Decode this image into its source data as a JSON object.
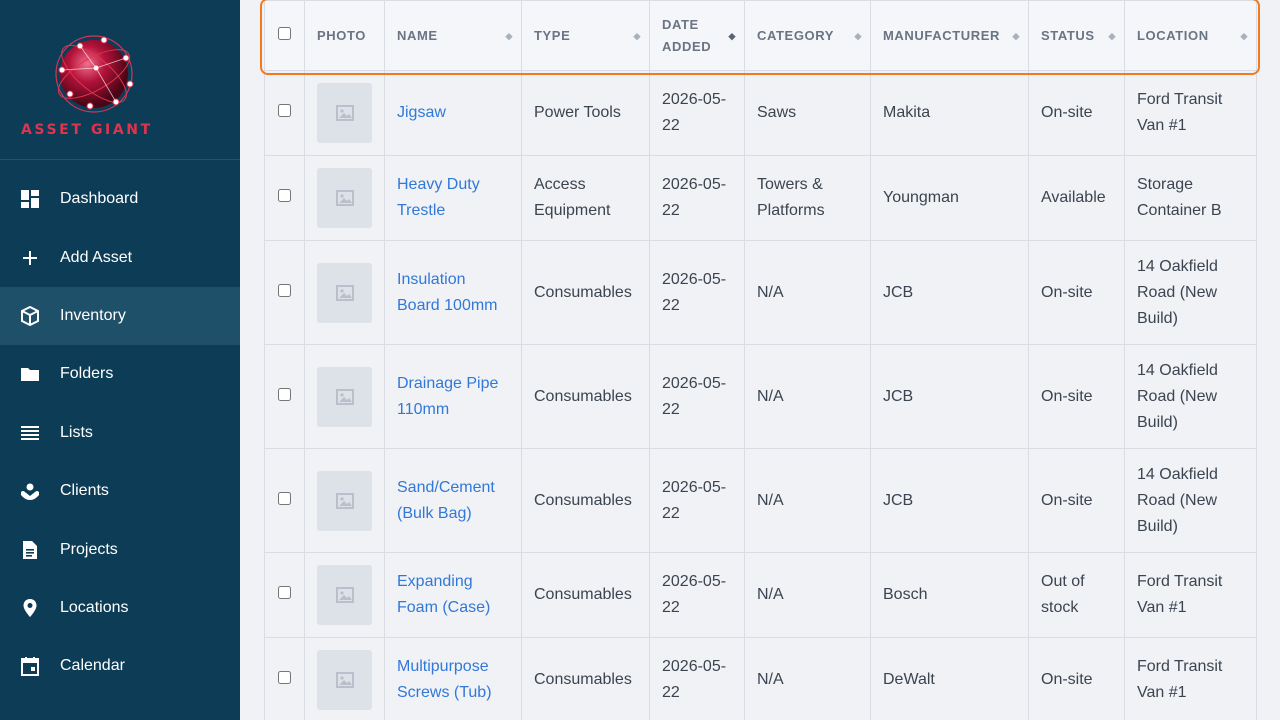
{
  "brand": {
    "name": "ASSET GIANT"
  },
  "sidebar": {
    "items": [
      {
        "label": "Dashboard",
        "icon": "dashboard-icon",
        "active": false
      },
      {
        "label": "Add Asset",
        "icon": "plus-icon",
        "active": false
      },
      {
        "label": "Inventory",
        "icon": "box-icon",
        "active": true
      },
      {
        "label": "Folders",
        "icon": "folder-icon",
        "active": false
      },
      {
        "label": "Lists",
        "icon": "list-icon",
        "active": false
      },
      {
        "label": "Clients",
        "icon": "clients-icon",
        "active": false
      },
      {
        "label": "Projects",
        "icon": "document-icon",
        "active": false
      },
      {
        "label": "Locations",
        "icon": "location-pin-icon",
        "active": false
      },
      {
        "label": "Calendar",
        "icon": "calendar-icon",
        "active": false
      }
    ]
  },
  "table": {
    "columns": [
      "PHOTO",
      "NAME",
      "TYPE",
      "DATE ADDED",
      "CATEGORY",
      "MANUFACTURER",
      "STATUS",
      "LOCATION"
    ],
    "sorted_column": "DATE ADDED",
    "rows": [
      {
        "name": "Jigsaw",
        "type": "Power Tools",
        "date": "2026-05-22",
        "category": "Saws",
        "manufacturer": "Makita",
        "status": "On-site",
        "location": "Ford Transit Van #1"
      },
      {
        "name": "Heavy Duty Trestle",
        "type": "Access Equipment",
        "date": "2026-05-22",
        "category": "Towers & Platforms",
        "manufacturer": "Youngman",
        "status": "Available",
        "location": "Storage Container B"
      },
      {
        "name": "Insulation Board 100mm",
        "type": "Consumables",
        "date": "2026-05-22",
        "category": "N/A",
        "manufacturer": "JCB",
        "status": "On-site",
        "location": "14 Oakfield Road (New Build)"
      },
      {
        "name": "Drainage Pipe 110mm",
        "type": "Consumables",
        "date": "2026-05-22",
        "category": "N/A",
        "manufacturer": "JCB",
        "status": "On-site",
        "location": "14 Oakfield Road (New Build)"
      },
      {
        "name": "Sand/Cement (Bulk Bag)",
        "type": "Consumables",
        "date": "2026-05-22",
        "category": "N/A",
        "manufacturer": "JCB",
        "status": "On-site",
        "location": "14 Oakfield Road (New Build)"
      },
      {
        "name": "Expanding Foam (Case)",
        "type": "Consumables",
        "date": "2026-05-22",
        "category": "N/A",
        "manufacturer": "Bosch",
        "status": "Out of stock",
        "location": "Ford Transit Van #1"
      },
      {
        "name": "Multipurpose Screws (Tub)",
        "type": "Consumables",
        "date": "2026-05-22",
        "category": "N/A",
        "manufacturer": "DeWalt",
        "status": "On-site",
        "location": "Ford Transit Van #1"
      }
    ]
  },
  "colors": {
    "sidebar_bg": "#0d3c57",
    "sidebar_active": "#1f5069",
    "brand_red": "#e0334d",
    "link_blue": "#3178d9",
    "highlight_orange": "#f07a1f"
  }
}
